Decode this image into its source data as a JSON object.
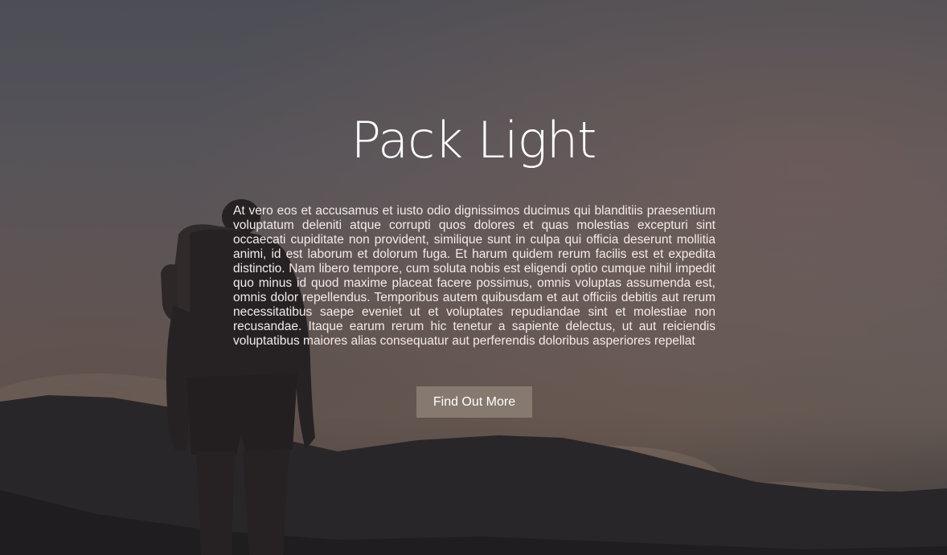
{
  "hero": {
    "title": "Pack Light",
    "body": "At vero eos et accusamus et iusto odio dignissimos ducimus qui blanditiis praesentium voluptatum deleniti atque corrupti quos dolores et quas molestias excepturi sint occaecati cupiditate non provident, similique sunt in culpa qui officia deserunt mollitia animi, id est laborum et dolorum fuga. Et harum quidem rerum facilis est et expedita distinctio. Nam libero tempore, cum soluta nobis est eligendi optio cumque nihil impedit quo minus id quod maxime placeat facere possimus, omnis voluptas assumenda est, omnis dolor repellendus. Temporibus autem quibusdam et aut officiis debitis aut rerum necessitatibus saepe eveniet ut et voluptates repudiandae sint et molestiae non recusandae. Itaque earum rerum hic tenetur a sapiente delectus, ut aut reiciendis voluptatibus maiores alias consequatur aut perferendis doloribus asperiores repellat",
    "cta_label": "Find Out More"
  },
  "colors": {
    "text": "#ffffff",
    "button_bg": "#8c8076",
    "sky_top": "#5f6169",
    "sky_bottom": "#7c6f66"
  }
}
